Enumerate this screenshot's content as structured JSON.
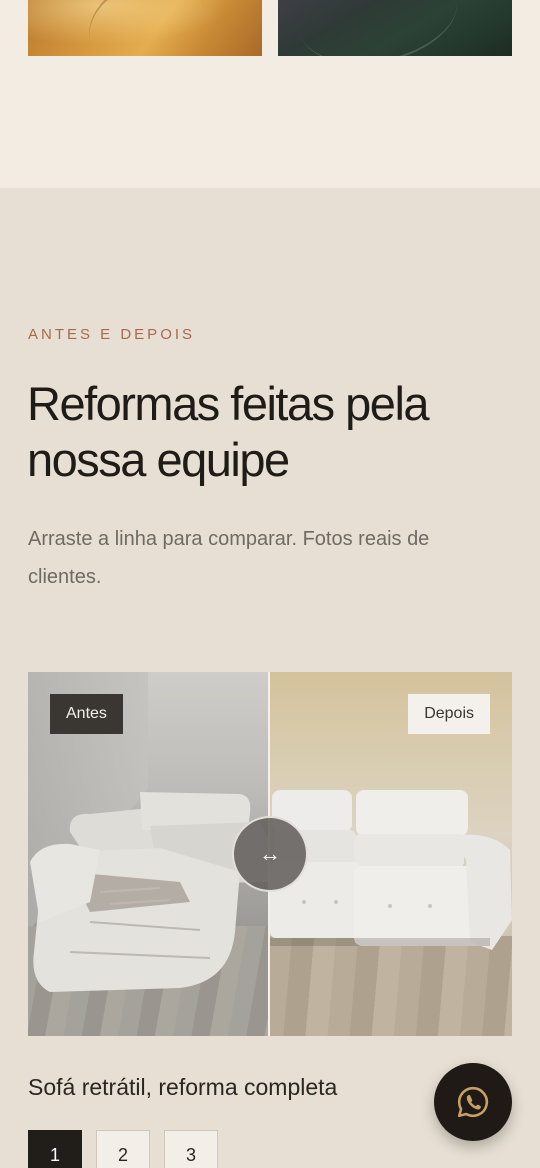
{
  "section": {
    "eyebrow": "ANTES E DEPOIS",
    "title": "Reformas feitas pela nossa equipe",
    "subtitle": "Arraste a linha para comparar. Fotos reais de clientes."
  },
  "compare": {
    "before_label": "Antes",
    "after_label": "Depois",
    "handle_icon": "arrows-horizontal-icon",
    "handle_glyph": "↔",
    "split_fraction": 0.5
  },
  "caption": "Sofá retrátil, reforma completa",
  "pagination": {
    "pages": [
      "1",
      "2",
      "3"
    ],
    "active": "1"
  },
  "floating": {
    "icon": "whatsapp-icon"
  },
  "colors": {
    "background": "#e7dfd3",
    "top_band": "#f2ece3",
    "eyebrow": "#a86a4a",
    "dark": "#211d19"
  }
}
